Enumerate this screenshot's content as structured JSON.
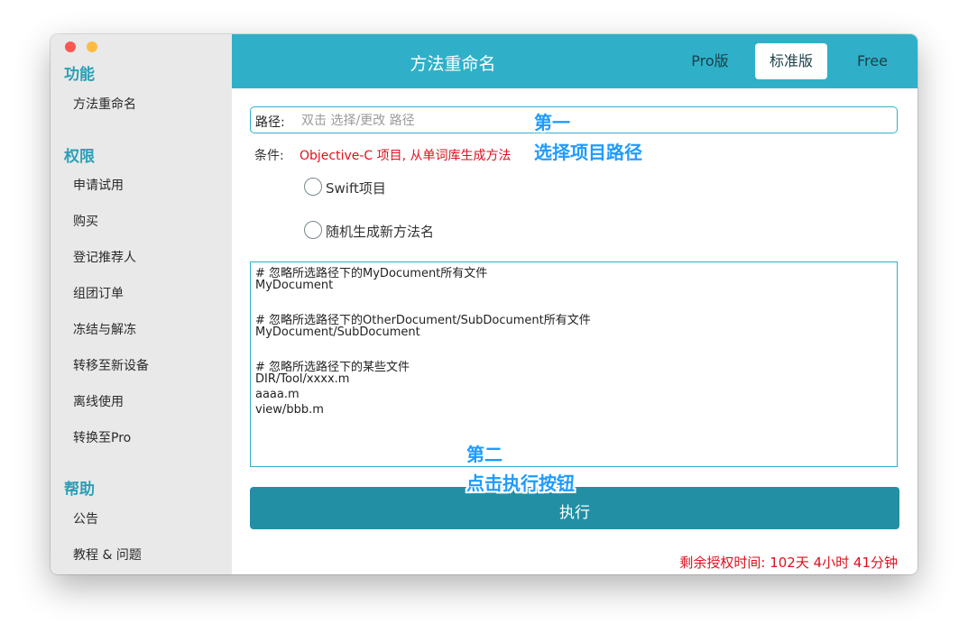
{
  "sidebar": {
    "sections": [
      {
        "title": "功能",
        "items": [
          "方法重命名"
        ]
      },
      {
        "title": "权限",
        "items": [
          "申请试用",
          "购买",
          "登记推荐人",
          "组团订单",
          "冻结与解冻",
          "转移至新设备",
          "离线使用",
          "转换至Pro"
        ]
      },
      {
        "title": "帮助",
        "items": [
          "公告",
          "教程 & 问题"
        ]
      }
    ]
  },
  "topbar": {
    "title": "方法重命名",
    "segments": [
      "Pro版",
      "标准版",
      "Free"
    ],
    "active_segment": "标准版"
  },
  "main": {
    "path_label": "路径:",
    "path_value": "",
    "path_placeholder": "双击 选择/更改 路径",
    "condition_label": "条件:",
    "condition_value": "Objective-C 项目, 从单词库生成方法",
    "radios": [
      "Swift项目",
      "随机生成新方法名"
    ],
    "ignore_lines": [
      "# 忽略所选路径下的MyDocument所有文件",
      "MyDocument",
      "",
      "# 忽略所选路径下的OtherDocument/SubDocument所有文件",
      "MyDocument/SubDocument",
      "",
      "# 忽略所选路径下的某些文件",
      "DIR/Tool/xxxx.m",
      "aaaa.m",
      "view/bbb.m"
    ],
    "execute_label": "执行",
    "remaining_time": "剩余授权时间: 102天  4小时 41分钟"
  },
  "annotations": {
    "step1_title": "第一",
    "step1_text": "选择项目路径",
    "step2_title": "第二",
    "step2_text": "点击执行按钮"
  },
  "colors": {
    "accent": "#2fb0c8",
    "button": "#238fa4",
    "warning": "#e0101e",
    "annotation": "#1f9bff"
  }
}
